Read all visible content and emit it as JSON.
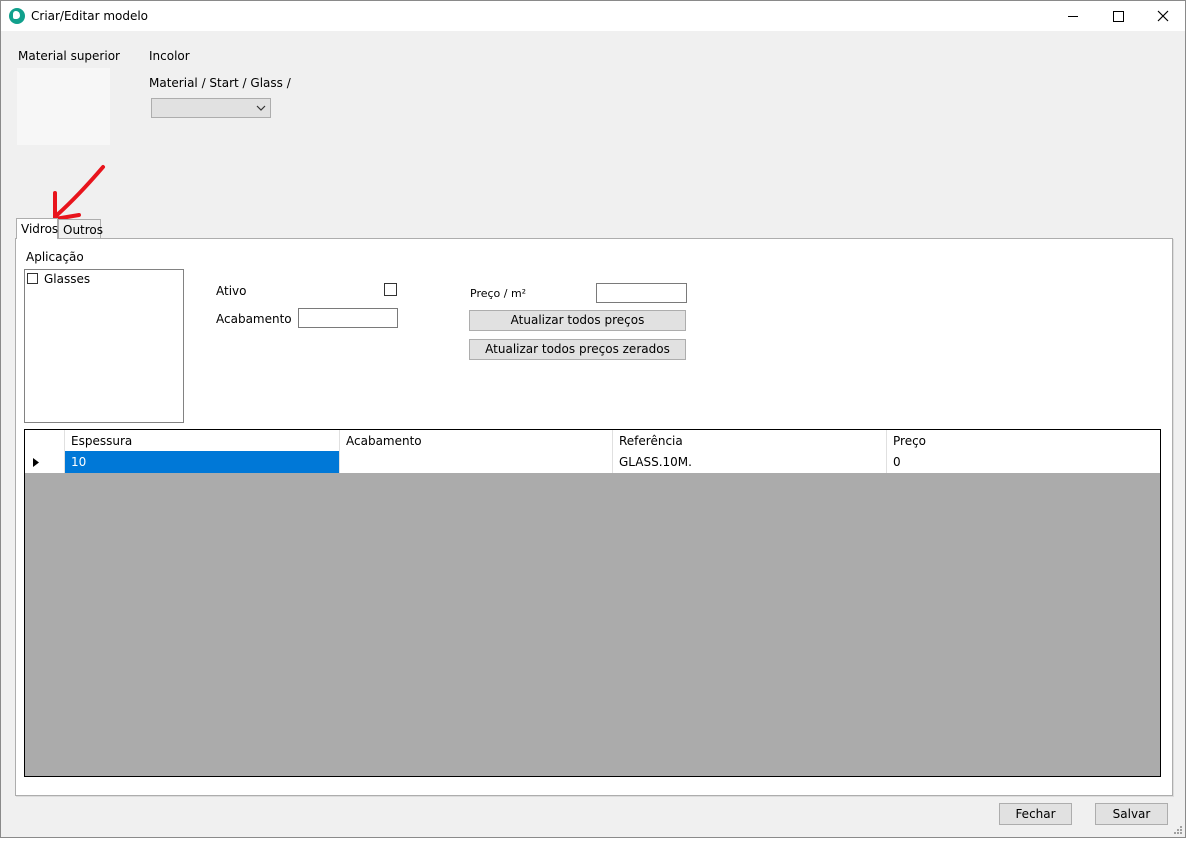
{
  "window": {
    "title": "Criar/Editar modelo"
  },
  "header": {
    "material_label": "Material superior",
    "color_name": "Incolor",
    "path": "Material / Start / Glass /",
    "combo_value": ""
  },
  "tabs": [
    {
      "label": "Vidros",
      "active": true
    },
    {
      "label": "Outros",
      "active": false
    }
  ],
  "form": {
    "aplicacao_label": "Aplicação",
    "aplicacao_items": [
      {
        "label": "Glasses",
        "checked": false
      }
    ],
    "ativo_label": "Ativo",
    "ativo_checked": false,
    "acabamento_label": "Acabamento",
    "acabamento_value": "",
    "preco_label": "Preço / m²",
    "preco_value": "",
    "update_all_label": "Atualizar todos preços",
    "update_zero_label": "Atualizar todos preços zerados"
  },
  "grid": {
    "columns": [
      "Espessura",
      "Acabamento",
      "Referência",
      "Preço"
    ],
    "rows": [
      [
        "10",
        "",
        "GLASS.10M.",
        "0"
      ]
    ]
  },
  "footer": {
    "close_label": "Fechar",
    "save_label": "Salvar"
  },
  "colors": {
    "selection": "#0078d7",
    "annotation_arrow": "#e8141c"
  }
}
